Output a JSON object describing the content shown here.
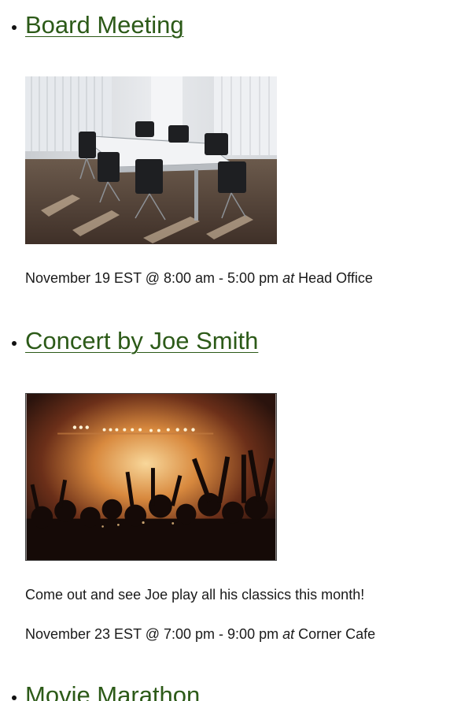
{
  "events": [
    {
      "title": "Board Meeting",
      "image_alt": "conference room with table and chairs",
      "date": "November 19 EST @ 8:00 am - 5:00 pm",
      "at_word": "at",
      "venue": "Head Office"
    },
    {
      "title": "Concert by Joe Smith",
      "image_alt": "crowd at a concert with stage lights",
      "description": "Come out and see Joe play all his classics this month!",
      "date": "November 23 EST @ 7:00 pm - 9:00 pm",
      "at_word": "at",
      "venue": "Corner Cafe"
    },
    {
      "title": "Movie Marathon"
    }
  ],
  "colors": {
    "link": "#2c5a18",
    "text": "#1a1a1a"
  }
}
